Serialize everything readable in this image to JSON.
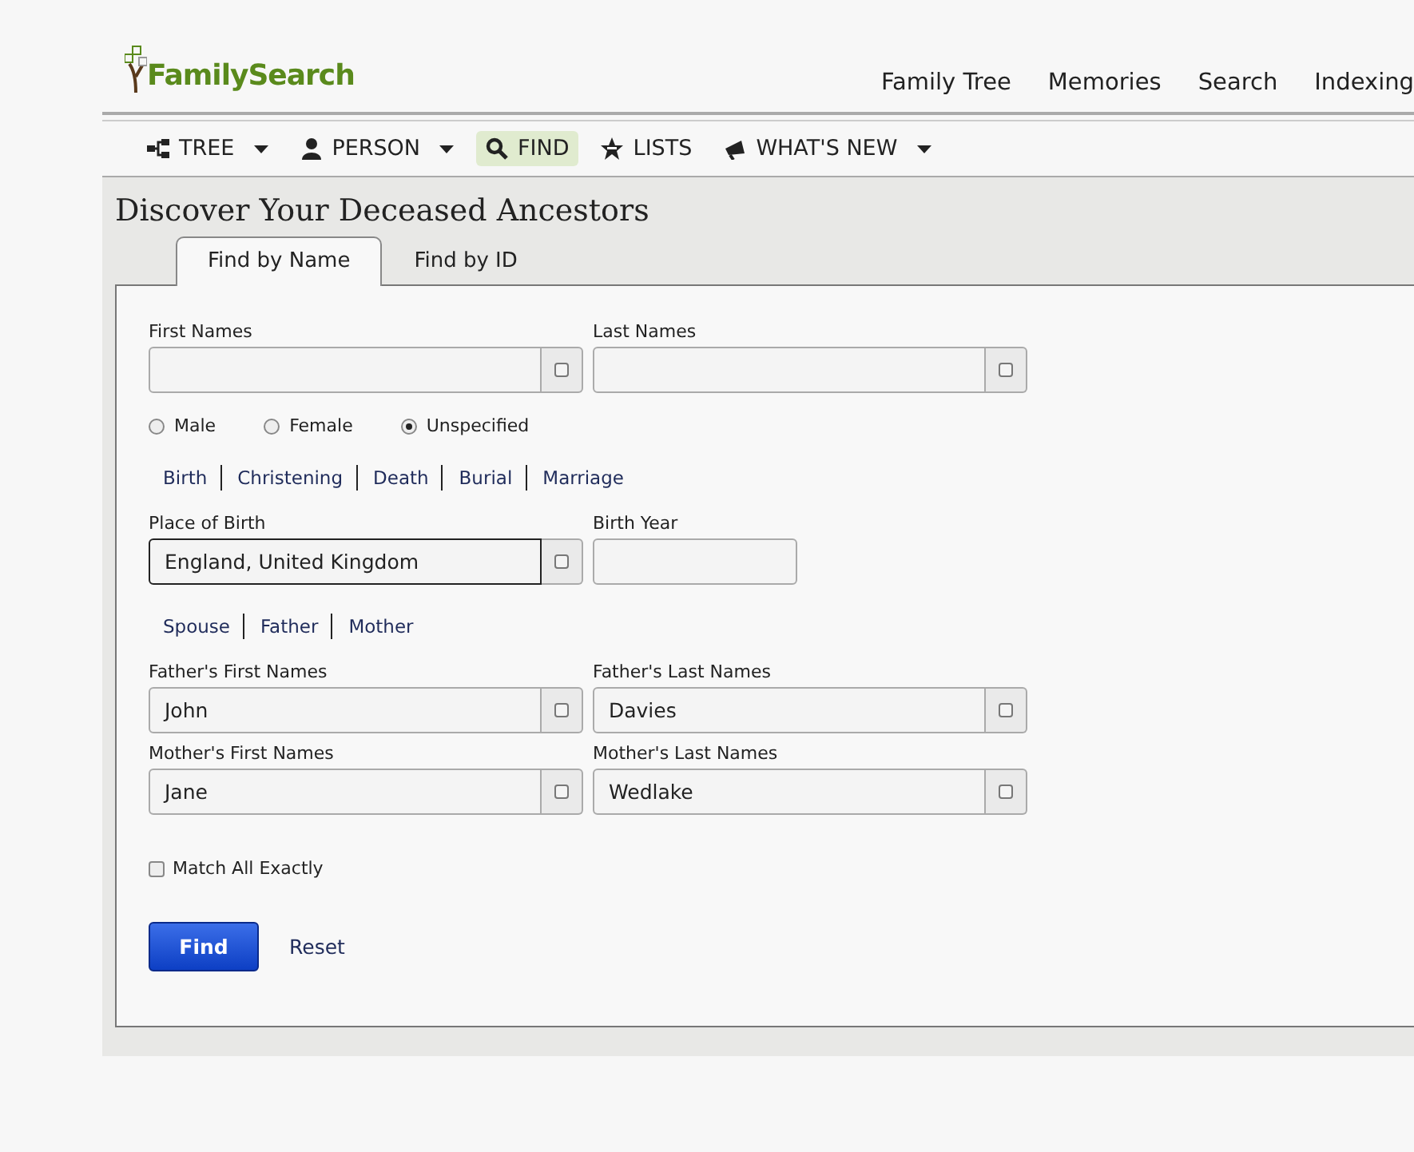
{
  "logo": {
    "text": "FamilySearch"
  },
  "nav": [
    "Family Tree",
    "Memories",
    "Search",
    "Indexing"
  ],
  "toolbar": [
    {
      "label": "TREE",
      "dropdown": true,
      "selected": false
    },
    {
      "label": "PERSON",
      "dropdown": true,
      "selected": false
    },
    {
      "label": "FIND",
      "dropdown": false,
      "selected": true
    },
    {
      "label": "LISTS",
      "dropdown": false,
      "selected": false
    },
    {
      "label": "WHAT'S NEW",
      "dropdown": true,
      "selected": false
    }
  ],
  "page_title": "Discover Your Deceased Ancestors",
  "tabs": [
    {
      "label": "Find by Name",
      "selected": true
    },
    {
      "label": "Find by ID",
      "selected": false
    }
  ],
  "name_fields": [
    {
      "label": "First Names",
      "kind": "lookup",
      "focused": false
    },
    {
      "label": "Last Names",
      "kind": "lookup",
      "focused": false
    }
  ],
  "gender": [
    {
      "label": "Male",
      "selected": false
    },
    {
      "label": "Female",
      "selected": false
    },
    {
      "label": "Unspecified",
      "selected": true
    }
  ],
  "event_links": [
    "Birth",
    "Christening",
    "Death",
    "Burial",
    "Marriage"
  ],
  "event_fields": [
    {
      "label": "Place of Birth",
      "value": "England, United Kingdom",
      "kind": "lookup",
      "focused": true
    },
    {
      "label": "Birth Year",
      "kind": "plain",
      "focused": false
    }
  ],
  "relative_links": [
    "Spouse",
    "Father",
    "Mother"
  ],
  "relative_fields": [
    {
      "label": "Father's First Names",
      "value": "John",
      "kind": "lookup",
      "focused": false
    },
    {
      "label": "Father's Last Names",
      "value": "Davies",
      "kind": "lookup",
      "focused": false
    },
    {
      "label": "Mother's First Names",
      "value": "Jane",
      "kind": "lookup",
      "focused": false
    },
    {
      "label": "Mother's Last Names",
      "value": "Wedlake",
      "kind": "lookup",
      "focused": false
    }
  ],
  "match_all_exactly": {
    "label": "Match All Exactly",
    "checked": false
  },
  "actions": {
    "find": "Find",
    "reset": "Reset"
  }
}
